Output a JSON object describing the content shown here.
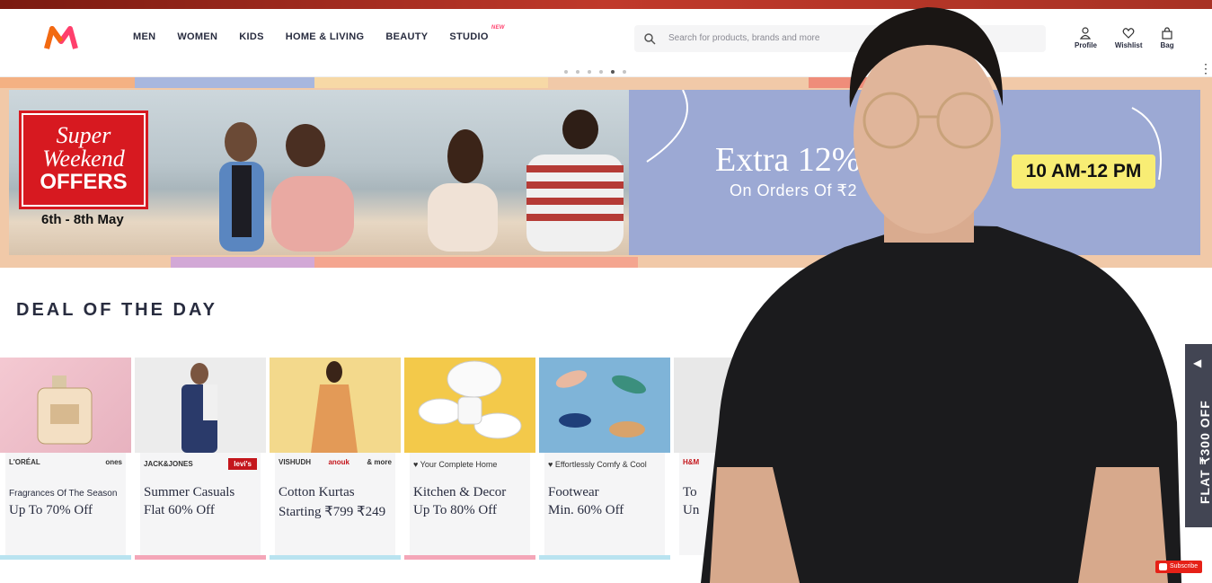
{
  "header": {
    "nav": [
      "MEN",
      "WOMEN",
      "KIDS",
      "HOME & LIVING",
      "BEAUTY",
      "STUDIO"
    ],
    "studio_badge": "NEW",
    "search_placeholder": "Search for products, brands and more",
    "actions": [
      {
        "label": "Profile",
        "icon": "profile-icon"
      },
      {
        "label": "Wishlist",
        "icon": "heart-icon"
      },
      {
        "label": "Bag",
        "icon": "bag-icon"
      }
    ]
  },
  "banner": {
    "offer_line1": "Super",
    "offer_line2": "Weekend",
    "offer_line3": "OFFERS",
    "dates": "6th - 8th May",
    "extra": "Extra 12%",
    "orders": "On Orders Of ₹2",
    "time": "10 AM-12 PM"
  },
  "deal_title": "DEAL OF THE DAY",
  "cards": [
    {
      "brands": [
        "L'ORÉAL",
        "ones"
      ],
      "line1": "Fragrances Of The Season",
      "line2": "Up To 70% Off"
    },
    {
      "brands": [
        "JACK&JONES",
        "levi's"
      ],
      "line1": "Summer Casuals",
      "line2": "Flat 60% Off"
    },
    {
      "brands": [
        "VISHUDH",
        "anouk",
        "& more"
      ],
      "line1": "Cotton Kurtas",
      "line2": "Starting ₹799 ₹249",
      "old_price": "₹799"
    },
    {
      "tag": "♥ Your Complete Home",
      "line1": "Kitchen & Decor",
      "line2": "Up To 80% Off"
    },
    {
      "tag": "♥ Effortlessly Comfy & Cool",
      "line1": "Footwear",
      "line2": "Min. 60% Off"
    },
    {
      "brands": [
        "H&M"
      ],
      "line1": "To",
      "line2": "Un"
    }
  ],
  "side_tab": "FLAT ₹300 OFF",
  "subscribe": "Subscribe",
  "colors": {
    "brand_pink": "#ff3f6c",
    "offer_red": "#d71920",
    "panel_blue": "#9ca9d4",
    "badge_yellow": "#f8ed74"
  }
}
